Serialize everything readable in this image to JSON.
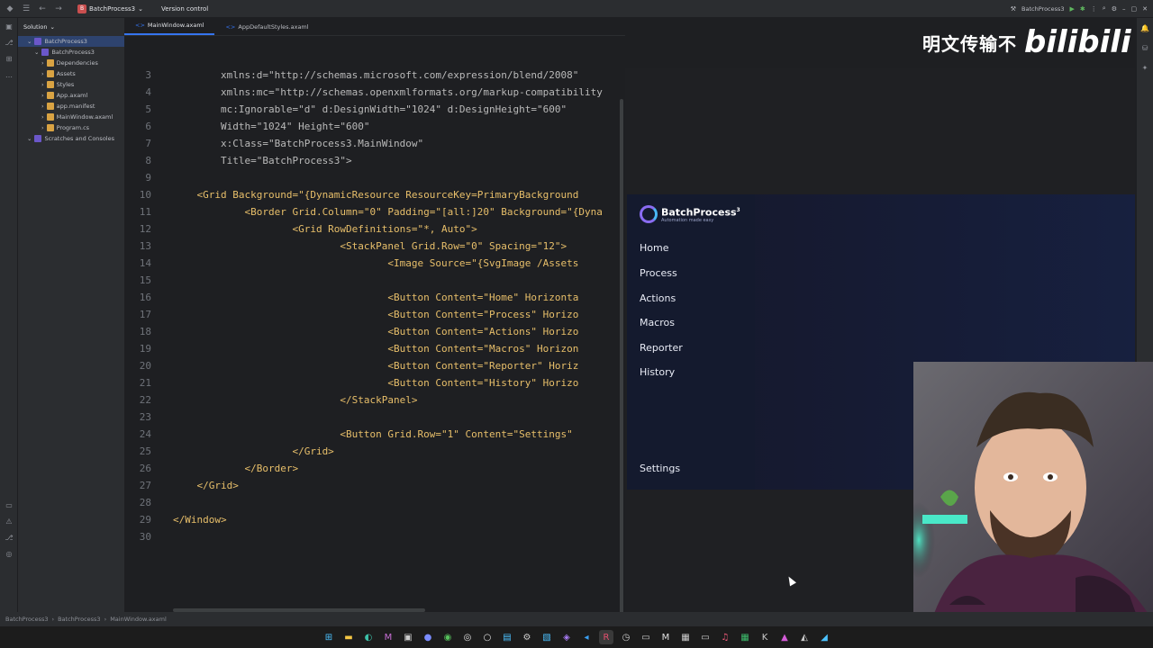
{
  "titlebar": {
    "project": "BatchProcess3",
    "project_initials": "B",
    "version_control": "Version control",
    "run_config": "BatchProcess3"
  },
  "solution": {
    "title": "Solution",
    "items": [
      {
        "label": "BatchProcess3",
        "indent": 0,
        "selected": true
      },
      {
        "label": "BatchProcess3",
        "indent": 1
      },
      {
        "label": "Dependencies",
        "indent": 2
      },
      {
        "label": "Assets",
        "indent": 2
      },
      {
        "label": "Styles",
        "indent": 2
      },
      {
        "label": "App.axaml",
        "indent": 2
      },
      {
        "label": "app.manifest",
        "indent": 2
      },
      {
        "label": "MainWindow.axaml",
        "indent": 2
      },
      {
        "label": "Program.cs",
        "indent": 2
      },
      {
        "label": "Scratches and Consoles",
        "indent": 0
      }
    ]
  },
  "tabs": [
    {
      "label": "MainWindow.axaml",
      "active": true
    },
    {
      "label": "AppDefaultStyles.axaml",
      "active": false
    }
  ],
  "code_lines": [
    {
      "n": "3",
      "text": "        xmlns:d=\"http://schemas.microsoft.com/expression/blend/2008\""
    },
    {
      "n": "4",
      "text": "        xmlns:mc=\"http://schemas.openxmlformats.org/markup-compatibility"
    },
    {
      "n": "5",
      "text": "        mc:Ignorable=\"d\" d:DesignWidth=\"1024\" d:DesignHeight=\"600\""
    },
    {
      "n": "6",
      "text": "        Width=\"1024\" Height=\"600\""
    },
    {
      "n": "7",
      "text": "        x:Class=\"BatchProcess3.MainWindow\""
    },
    {
      "n": "8",
      "text": "        Title=\"BatchProcess3\">"
    },
    {
      "n": "9",
      "text": ""
    },
    {
      "n": "10",
      "text": "    <Grid Background=\"{DynamicResource ResourceKey=PrimaryBackground"
    },
    {
      "n": "11",
      "text": "            <Border Grid.Column=\"0\" Padding=\"[all:]20\" Background=\"{Dyna"
    },
    {
      "n": "12",
      "text": "                    <Grid RowDefinitions=\"*, Auto\">"
    },
    {
      "n": "13",
      "text": "                            <StackPanel Grid.Row=\"0\" Spacing=\"12\">"
    },
    {
      "n": "14",
      "text": "                                    <Image Source=\"{SvgImage /Assets"
    },
    {
      "n": "15",
      "text": ""
    },
    {
      "n": "16",
      "text": "                                    <Button Content=\"Home\" Horizonta"
    },
    {
      "n": "17",
      "text": "                                    <Button Content=\"Process\" Horizo"
    },
    {
      "n": "18",
      "text": "                                    <Button Content=\"Actions\" Horizo"
    },
    {
      "n": "19",
      "text": "                                    <Button Content=\"Macros\" Horizon"
    },
    {
      "n": "20",
      "text": "                                    <Button Content=\"Reporter\" Horiz"
    },
    {
      "n": "21",
      "text": "                                    <Button Content=\"History\" Horizo"
    },
    {
      "n": "22",
      "text": "                            </StackPanel>"
    },
    {
      "n": "23",
      "text": ""
    },
    {
      "n": "24",
      "text": "                            <Button Grid.Row=\"1\" Content=\"Settings\""
    },
    {
      "n": "25",
      "text": "                    </Grid>"
    },
    {
      "n": "26",
      "text": "            </Border>"
    },
    {
      "n": "27",
      "text": "    </Grid>"
    },
    {
      "n": "28",
      "text": ""
    },
    {
      "n": "29",
      "text": "</Window>"
    },
    {
      "n": "30",
      "text": ""
    }
  ],
  "preview": {
    "logo_title": "BatchProcess",
    "logo_sup": "3",
    "logo_tagline": "Automation made easy",
    "nav": [
      "Home",
      "Process",
      "Actions",
      "Macros",
      "Reporter",
      "History"
    ],
    "settings": "Settings"
  },
  "watermark": {
    "cn": "明文传输不",
    "bili": "bilibili"
  },
  "statusbar": {
    "crumbs": [
      "BatchProcess3",
      "BatchProcess3",
      "MainWindow.axaml"
    ]
  },
  "colors": {
    "accent": "#3574f0",
    "preview_bg": "#161c36",
    "logo_purple": "#8a6cf2",
    "logo_blue": "#49b8f5"
  }
}
